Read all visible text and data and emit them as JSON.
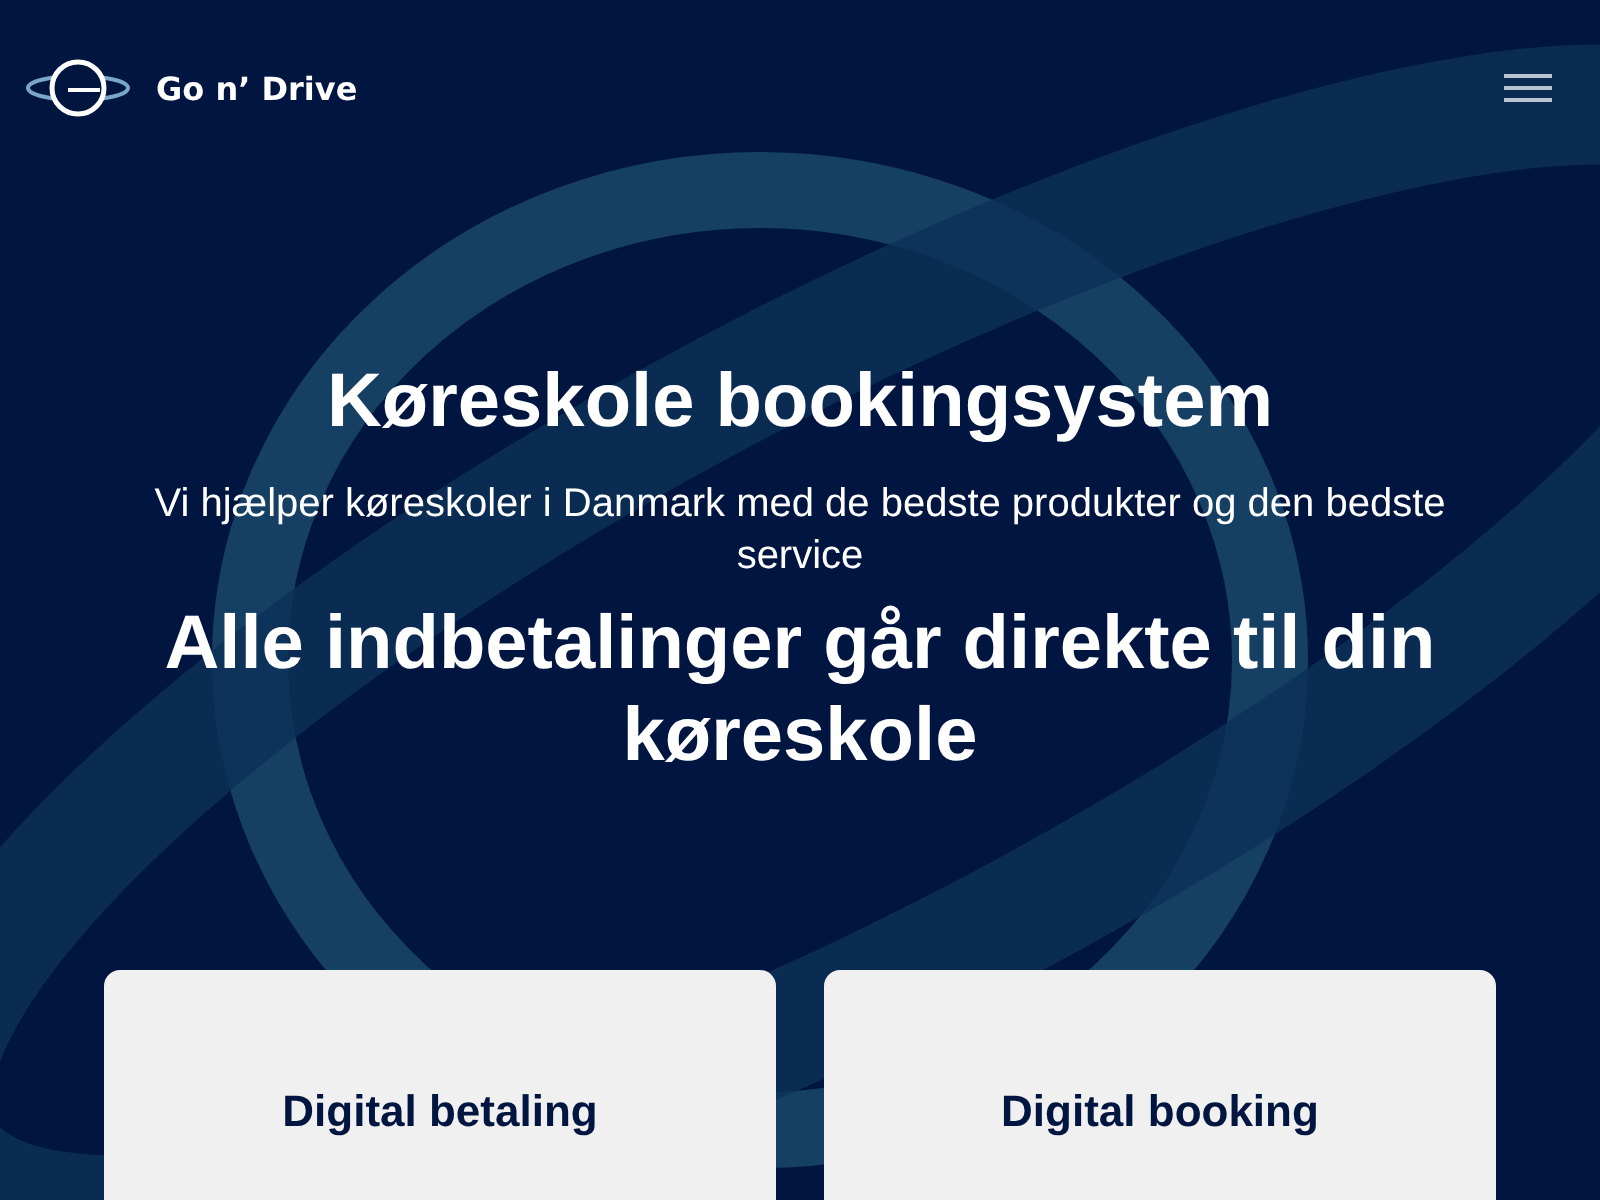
{
  "header": {
    "brand": "Go n’ Drive"
  },
  "hero": {
    "title": "Køreskole bookingsystem",
    "subtitle": "Vi hjælper køreskoler i Danmark med de bedste produkter og den bedste service",
    "headline": "Alle indbetalinger går direkte til din køreskole"
  },
  "cards": [
    {
      "title": "Digital betaling"
    },
    {
      "title": "Digital booking"
    }
  ]
}
